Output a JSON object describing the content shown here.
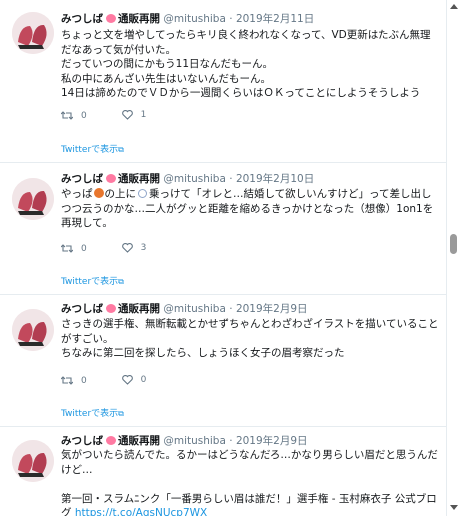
{
  "tweets": [
    {
      "name": "みつしば",
      "label": "通販再開",
      "handle": "@mitushiba",
      "separator": "·",
      "date": "2019年2月11日",
      "text": "ちょっと文を増やしてったらキリ良く終われなくなって、VD更新はたぶん無理だなあって気が付いた。\nだっていつの間にかもう11日なんだもーん。\n私の中にあんざい先生はいないんだもーん。\n14日は諦めたのでＶＤから一週間くらいはＯＫってことにしようそうしよう",
      "retweets": "0",
      "likes": "1",
      "view_on_twitter": "Twitterで表示"
    },
    {
      "name": "みつしば",
      "label": "通販再開",
      "handle": "@mitushiba",
      "separator": "·",
      "date": "2019年2月10日",
      "text_before": "やっぱ",
      "text_mid": "の上に",
      "text_after": "乗っけて「オレと…結婚して欲しいんすけど」って差し出しつつ云うのかな…二人がグッと距離を縮めるきっかけとなった（想像）1on1を再現して。",
      "retweets": "0",
      "likes": "3",
      "view_on_twitter": "Twitterで表示"
    },
    {
      "name": "みつしば",
      "label": "通販再開",
      "handle": "@mitushiba",
      "separator": "·",
      "date": "2019年2月9日",
      "text": "さっきの選手権、無断転載とかせずちゃんとわざわざイラストを描いていることがすごい。\nちなみに第二回を探したら、しょうほく女子の眉考察だった",
      "retweets": "0",
      "likes": "0",
      "view_on_twitter": "Twitterで表示"
    },
    {
      "name": "みつしば",
      "label": "通販再開",
      "handle": "@mitushiba",
      "separator": "·",
      "date": "2019年2月9日",
      "text": "気がついたら読んでた。るかーはどうなんだろ…かなり男らしい眉だと思うんだけど…\n\n第一回・スラムﾆンク「一番男らしい眉は誰だ！」選手権 - 玉村麻衣子 公式ブログ ",
      "link": "https://t.co/AgsNUcp7WX"
    }
  ],
  "icons": {
    "retweet": "retweet-icon",
    "like": "heart-icon",
    "external": "external-link-icon",
    "emoji_pig": "pig-face-emoji",
    "emoji_ball": "basketball-emoji",
    "emoji_ring": "ring-emoji"
  },
  "colors": {
    "text": "#14171a",
    "secondary": "#657786",
    "link": "#1b95e0",
    "divider": "#e6ecf0"
  }
}
